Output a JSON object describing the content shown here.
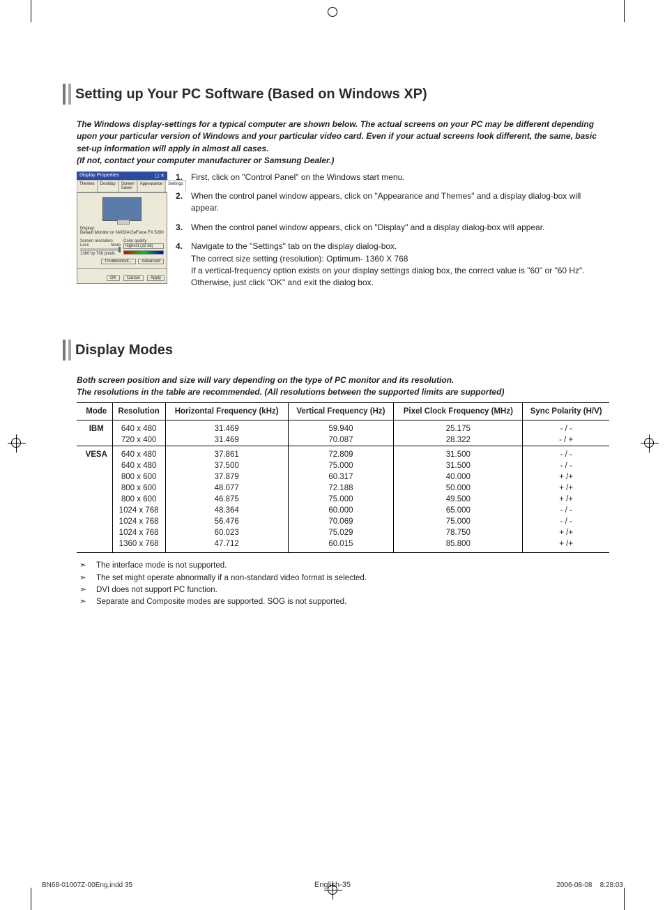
{
  "section1": {
    "title": "Setting up Your PC Software (Based on Windows XP)",
    "intro": "The Windows display-settings for a typical computer are shown below. The actual screens on your PC may be different depending upon your particular version of Windows and your particular video card. Even if your actual screens look different, the same, basic set-up information will apply in almost all cases.\n(If not, contact your computer manufacturer or Samsung Dealer.)",
    "screenshot": {
      "title": "Display Properties",
      "tabs": [
        "Themes",
        "Desktop",
        "Screen Saver",
        "Appearance",
        "Settings"
      ],
      "display_text": "Default Monitor on NVIDIA GeForce FX 5200",
      "res_label": "Screen resolution",
      "res_value": "1360 by 768 pixels",
      "less": "Less",
      "more": "More",
      "color_label": "Color quality",
      "color_value": "Highest (32 bit)",
      "btn_trouble": "Troubleshoot...",
      "btn_adv": "Advanced",
      "btn_ok": "OK",
      "btn_cancel": "Cancel",
      "btn_apply": "Apply"
    },
    "steps": [
      {
        "text": "First, click on \"Control Panel\" on the Windows start menu."
      },
      {
        "text": "When the control panel window appears, click on \"Appearance and Themes\" and a display dialog-box will appear."
      },
      {
        "text": "When the control panel window appears, click on \"Display\" and a display dialog-box will appear."
      },
      {
        "text": "Navigate to the \"Settings\" tab on the display dialog-box.",
        "sub1": "The correct size setting (resolution): Optimum- 1360 X 768",
        "sub2": "If a vertical-frequency option exists on your display settings dialog box, the correct value is \"60\" or \"60 Hz\". Otherwise, just click \"OK\" and exit the dialog box."
      }
    ]
  },
  "section2": {
    "title": "Display Modes",
    "intro": "Both screen position and size will vary depending on the type of PC monitor and its resolution.\nThe resolutions in the table are recommended. (All resolutions between the supported limits are supported)",
    "headers": [
      "Mode",
      "Resolution",
      "Horizontal Frequency (kHz)",
      "Vertical Frequency (Hz)",
      "Pixel Clock Frequency (MHz)",
      "Sync Polarity (H/V)"
    ],
    "groups": [
      {
        "mode": "IBM",
        "rows": [
          {
            "res": "640 x 480",
            "h": "31.469",
            "v": "59.940",
            "p": "25.175",
            "s": "- / -"
          },
          {
            "res": "720 x 400",
            "h": "31.469",
            "v": "70.087",
            "p": "28.322",
            "s": "- / +"
          }
        ]
      },
      {
        "mode": "VESA",
        "rows": [
          {
            "res": "640 x 480",
            "h": "37.861",
            "v": "72.809",
            "p": "31.500",
            "s": "- / -"
          },
          {
            "res": "640 x 480",
            "h": "37.500",
            "v": "75.000",
            "p": "31.500",
            "s": "- / -"
          },
          {
            "res": "800 x 600",
            "h": "37.879",
            "v": "60.317",
            "p": "40.000",
            "s": "+ /+"
          },
          {
            "res": "800 x 600",
            "h": "48.077",
            "v": "72.188",
            "p": "50.000",
            "s": "+ /+"
          },
          {
            "res": "800 x 600",
            "h": "46.875",
            "v": "75.000",
            "p": "49.500",
            "s": "+ /+"
          },
          {
            "res": "1024 x 768",
            "h": "48.364",
            "v": "60.000",
            "p": "65.000",
            "s": "- / -"
          },
          {
            "res": "1024 x 768",
            "h": "56.476",
            "v": "70.069",
            "p": "75.000",
            "s": "- / -"
          },
          {
            "res": "1024 x 768",
            "h": "60.023",
            "v": "75.029",
            "p": "78.750",
            "s": "+ /+"
          },
          {
            "res": "1360 x 768",
            "h": "47.712",
            "v": "60.015",
            "p": "85.800",
            "s": "+ /+"
          }
        ]
      }
    ],
    "notes": [
      "The interface mode is not supported.",
      "The set might operate abnormally if a non-standard video format is selected.",
      "DVI does not support PC function.",
      "Separate and Composite modes are supported. SOG is not supported."
    ]
  },
  "footer": {
    "page": "English-35",
    "left": "BN68-01007Z-00Eng.indd   35",
    "date": "2006-08-08",
    "time": "8:28:03"
  }
}
